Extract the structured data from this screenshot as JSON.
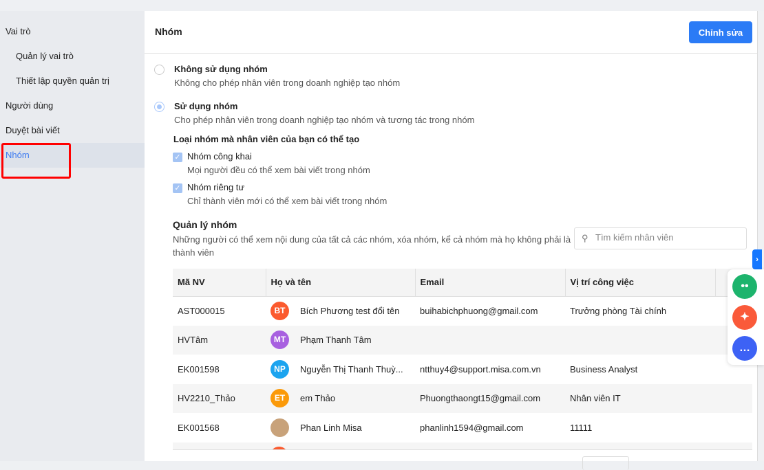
{
  "sidebar": {
    "items": [
      {
        "label": "Vai trò"
      },
      {
        "label": "Quản lý vai trò"
      },
      {
        "label": "Thiết lập quyền quản trị"
      },
      {
        "label": "Người dùng"
      },
      {
        "label": "Duyệt bài viết"
      },
      {
        "label": "Nhóm"
      }
    ]
  },
  "header": {
    "title": "Nhóm",
    "edit_label": "Chỉnh sửa"
  },
  "options": {
    "none": {
      "label": "Không sử dụng nhóm",
      "desc": "Không cho phép nhân viên trong doanh nghiệp tạo nhóm",
      "selected": false
    },
    "use": {
      "label": "Sử dụng nhóm",
      "desc": "Cho phép nhân viên trong doanh nghiệp tạo nhóm và tương tác trong nhóm",
      "selected": true
    },
    "types_title": "Loại nhóm mà nhân viên của bạn có thể tạo",
    "public": {
      "label": "Nhóm công khai",
      "desc": "Mọi người đều có thể xem bài viết trong nhóm",
      "checked": true
    },
    "private": {
      "label": "Nhóm riêng tư",
      "desc": "Chỉ thành viên mới có thể xem bài viết trong nhóm",
      "checked": true
    }
  },
  "manage": {
    "title": "Quản lý nhóm",
    "desc": "Những người có thể xem nội dung của tất cả các nhóm, xóa nhóm, kể cả nhóm mà họ không phải là thành viên",
    "search_placeholder": "Tìm kiếm nhân viên"
  },
  "table": {
    "headers": [
      "Mã NV",
      "Họ và tên",
      "Email",
      "Vị trí công việc"
    ],
    "rows": [
      {
        "code": "AST000015",
        "initials": "BT",
        "color": "#fb5a2e",
        "name": "Bích Phương test đổi tên",
        "email": "buihabichphuong@gmail.com",
        "position": "Trưởng phòng Tài chính"
      },
      {
        "code": "HVTâm",
        "initials": "MT",
        "color": "#a860e0",
        "name": "Phạm Thanh Tâm",
        "email": "",
        "position": ""
      },
      {
        "code": "EK001598",
        "initials": "NP",
        "color": "#1ca4ef",
        "name": "Nguyễn Thị Thanh Thuỳ...",
        "email": "ntthuy4@support.misa.com.vn",
        "position": "Business Analyst"
      },
      {
        "code": "HV2210_Thảo",
        "initials": "ET",
        "color": "#fb9a0a",
        "name": "em Thảo",
        "email": "Phuongthaongt15@gmail.com",
        "position": "Nhân viên IT"
      },
      {
        "code": "EK001568",
        "initials": "",
        "color": "#c8a27a",
        "name": "Phan Linh Misa",
        "email": "phanlinh1594@gmail.com",
        "position": "11111"
      }
    ]
  }
}
